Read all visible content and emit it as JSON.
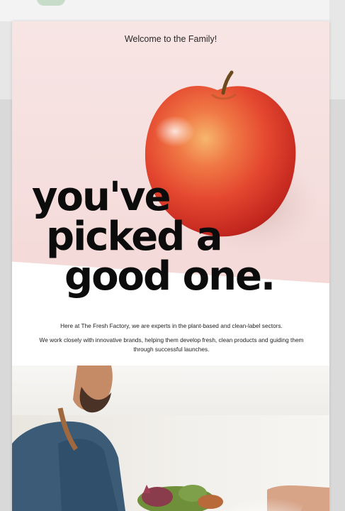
{
  "email": {
    "eyebrow": "Welcome to the Family!",
    "headline": {
      "line1": "you've",
      "line2": "picked a",
      "line3": "good one."
    },
    "body": {
      "p1": "Here at The Fresh Factory, we are experts in the plant-based and clean-label sectors.",
      "p2": "We work closely with innovative brands, helping them develop fresh, clean products and guiding them through successful launches."
    },
    "images": {
      "hero": "red-apple-image",
      "feature": "man-with-vegetables-photo"
    }
  },
  "colors": {
    "hero_background": "#f5dedd",
    "text": "#0c0c0c",
    "page_background": "#d9d9d9"
  }
}
